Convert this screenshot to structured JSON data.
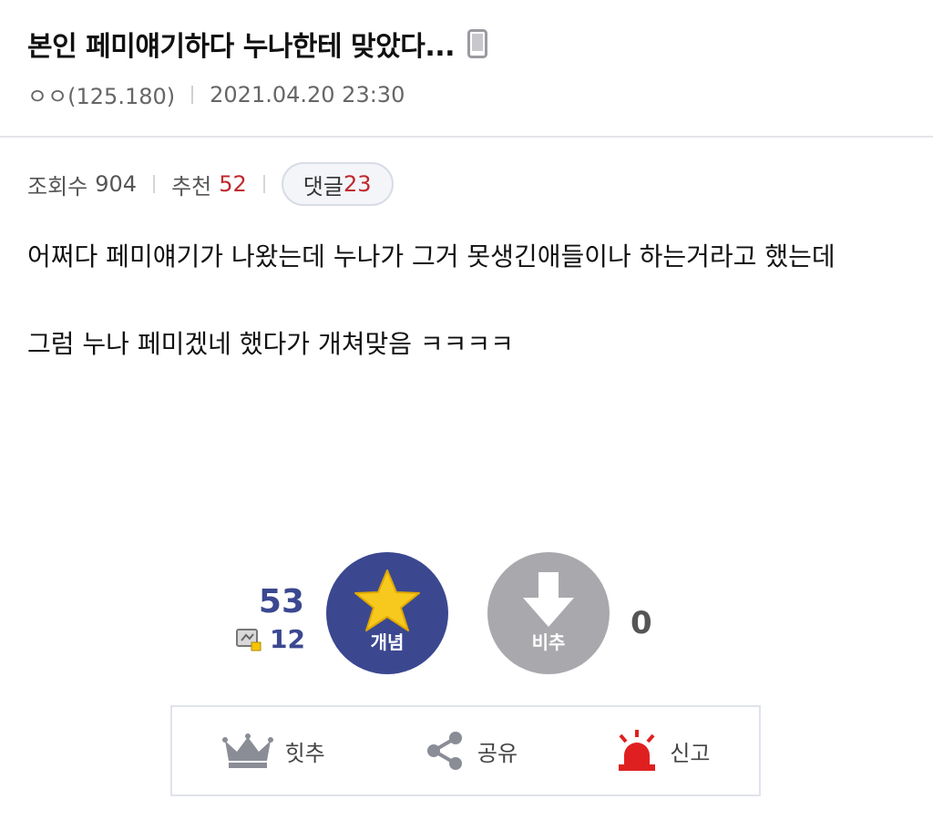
{
  "post": {
    "title": "본인 페미얘기하다 누나한테 맞았다...",
    "author": "ㅇㅇ(125.180)",
    "datetime": "2021.04.20 23:30"
  },
  "stats": {
    "views_label": "조회수",
    "views": "904",
    "recommend_label": "추천",
    "recommend": "52",
    "comments_label": "댓글",
    "comments": "23"
  },
  "body": {
    "line1": "어쩌다 페미얘기가 나왔는데 누나가 그거 못생긴애들이나 하는거라고 했는데",
    "line2": "그럼 누나 페미겠네 했다가 개쳐맞음 ㅋㅋㅋㅋ"
  },
  "vote": {
    "up_count": "53",
    "fixed_count": "12",
    "up_label": "개념",
    "down_label": "비추",
    "down_count": "0",
    "up_color": "#3b4890",
    "down_color": "#a9a9ad",
    "star_color": "#f7c81e"
  },
  "actions": {
    "hit_label": "힛추",
    "share_label": "공유",
    "report_label": "신고",
    "report_color": "#e02020"
  },
  "icons": {
    "device": "mobile-phone-icon",
    "fixed": "fixed-user-icon",
    "up": "star-icon",
    "down": "arrow-down-icon",
    "hit": "crown-icon",
    "share": "share-icon",
    "report": "siren-icon"
  }
}
